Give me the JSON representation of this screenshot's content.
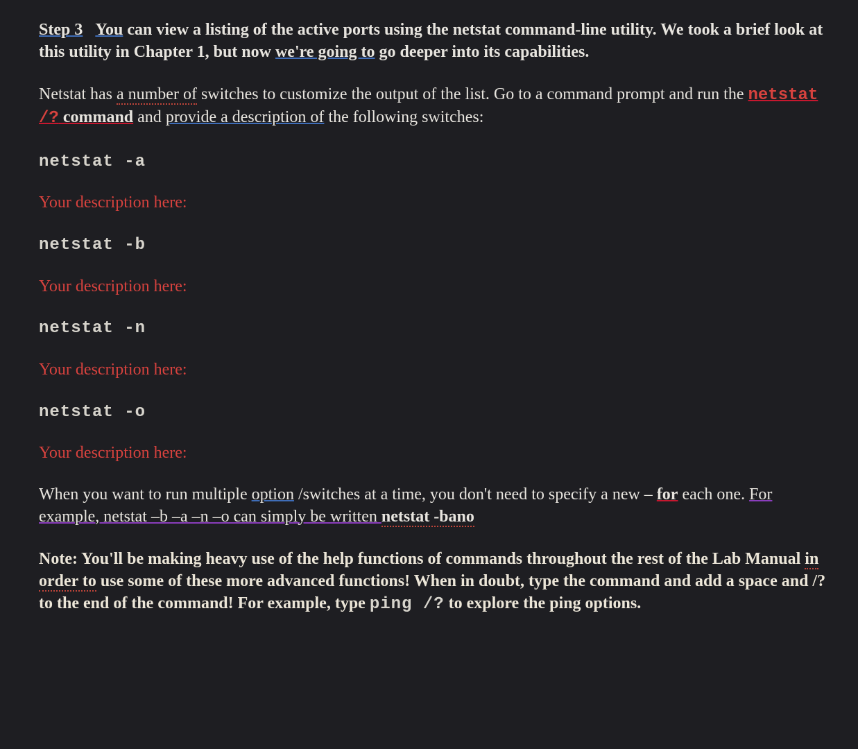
{
  "intro": {
    "step_label": "Step 3",
    "sentence1_part1": "You",
    "sentence1_rest": " can view a listing of the active ports using the netstat command-line utility.  We took a brief look at this utility in Chapter 1, but now ",
    "sentence1_underlined": "we're going to",
    "sentence1_tail": " go deeper into its capabilities."
  },
  "paragraph2": {
    "pre": "Netstat has ",
    "a_number_of": "a number of",
    "mid1": " switches to customize the output of the list. Go to a command prompt and run the ",
    "cmd": "netstat /?",
    "command_word": " command",
    "mid2": " and ",
    "provide": "provide a description of",
    "tail": " the following switches:"
  },
  "commands": [
    {
      "cmd": "netstat -a",
      "desc": "Your description here:"
    },
    {
      "cmd": "netstat -b",
      "desc": "Your description here:"
    },
    {
      "cmd": "netstat -n",
      "desc": "Your description here:"
    },
    {
      "cmd": "netstat -o",
      "desc": "Your description here:"
    }
  ],
  "paragraph3": {
    "pre": "When you want to run multiple ",
    "option": "option",
    "mid1": " /switches at a time, you don't need to specify a new – ",
    "for_word": "for",
    "mid2": " each one. ",
    "example_underlined": "For example, netstat –b –a –n –o can simply be written ",
    "example_bold": "netstat -bano"
  },
  "note": {
    "label": "Note:   ",
    "part1": "You'll be making heavy use of the help functions of commands throughout the rest of the Lab Manual ",
    "in_order_to": "in order to",
    "part2": " use some of these more advanced functions! When in doubt, type the command and add a space and /? to the end of the command! For example, type ",
    "cmd": "ping /?",
    "part3": " to explore the ping options."
  }
}
